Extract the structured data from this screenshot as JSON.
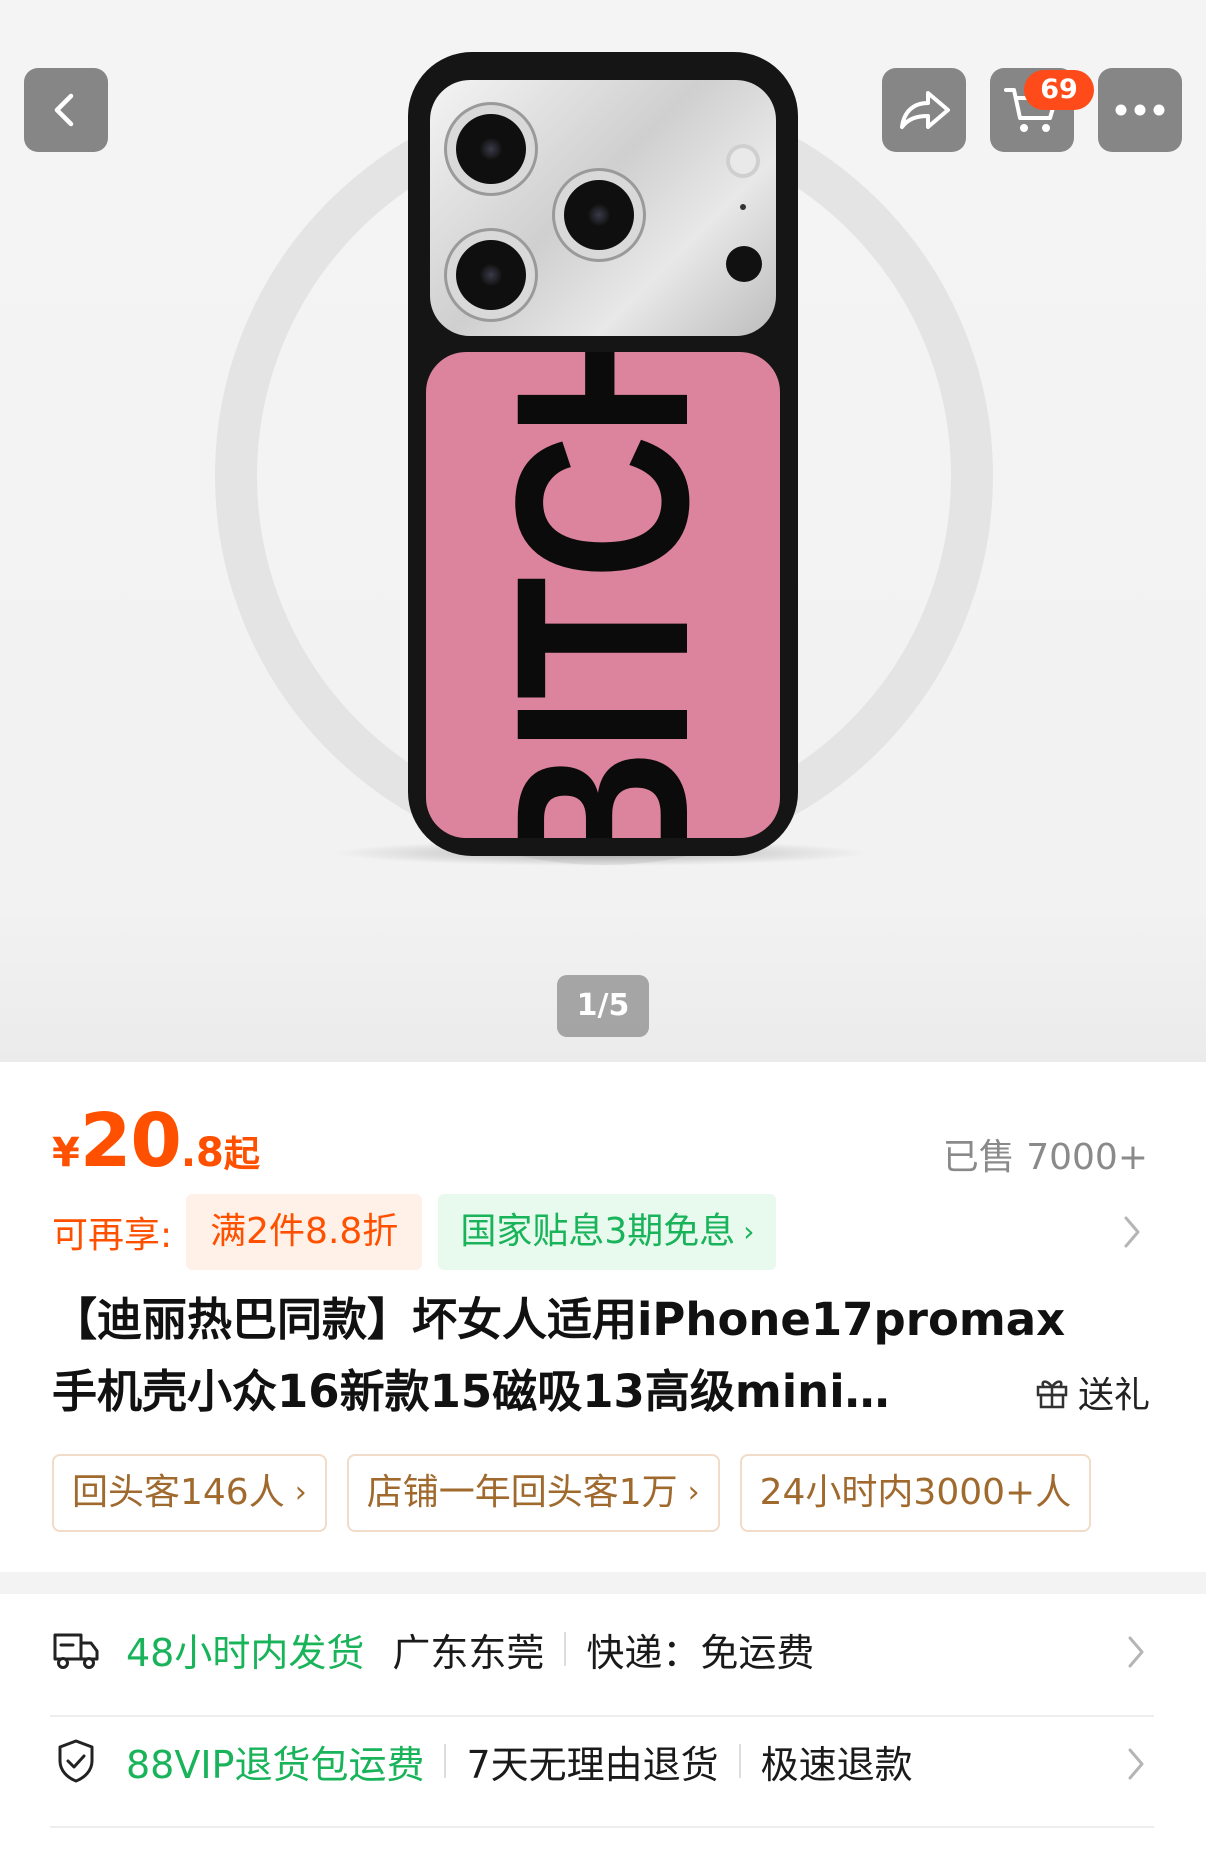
{
  "hero": {
    "case_print": "BITCH",
    "pager": "1/5"
  },
  "topbar": {
    "cart_count": "69"
  },
  "price": {
    "currency": "¥",
    "integer": "20",
    "decimal": ".8",
    "suffix": "起",
    "sold": "已售 7000+"
  },
  "promo": {
    "label": "可再享:",
    "discount_tag": "满2件8.8折",
    "installment_tag": "国家贴息3期免息",
    "installment_chevron": "›"
  },
  "title": {
    "line1": "【迪丽热巴同款】坏女人适用iPhone17promax",
    "line2": "手机壳小众16新款15磁吸13高级mini…",
    "gift": "送礼"
  },
  "tags": [
    {
      "label": "回头客146人",
      "chev": "›"
    },
    {
      "label": "店铺一年回头客1万",
      "chev": "›"
    },
    {
      "label": "24小时内3000+人",
      "chev": ""
    }
  ],
  "service": {
    "shipping": {
      "highlight": "48小时内发货",
      "origin": "广东东莞",
      "delivery": "快递：免运费"
    },
    "returns": {
      "highlight": "88VIP退货包运费",
      "policy": "7天无理由退货",
      "refund": "极速退款"
    }
  },
  "colors": {
    "price": "#ff5000",
    "green": "#19b35a",
    "case_pink": "#dc839d",
    "tag_text": "#a06a2e"
  }
}
